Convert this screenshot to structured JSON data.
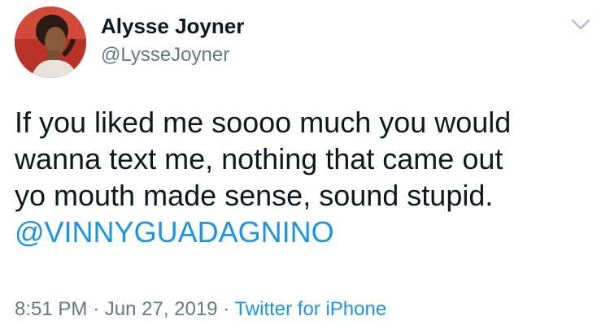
{
  "author": {
    "display_name": "Alysse Joyner",
    "handle": "@LysseJoyner"
  },
  "tweet": {
    "lines": [
      "If you liked me soooo much you would",
      "wanna text me, nothing that came out",
      "yo mouth made sense, sound stupid."
    ],
    "mention": "@VINNYGUADAGNINO"
  },
  "meta": {
    "time": "8:51 PM",
    "separator": "·",
    "date": "Jun 27, 2019",
    "source": "Twitter for iPhone"
  },
  "icons": {
    "menu": "chevron-down-icon"
  },
  "colors": {
    "link": "#1b95e0",
    "text": "#14171a",
    "muted": "#657786"
  }
}
